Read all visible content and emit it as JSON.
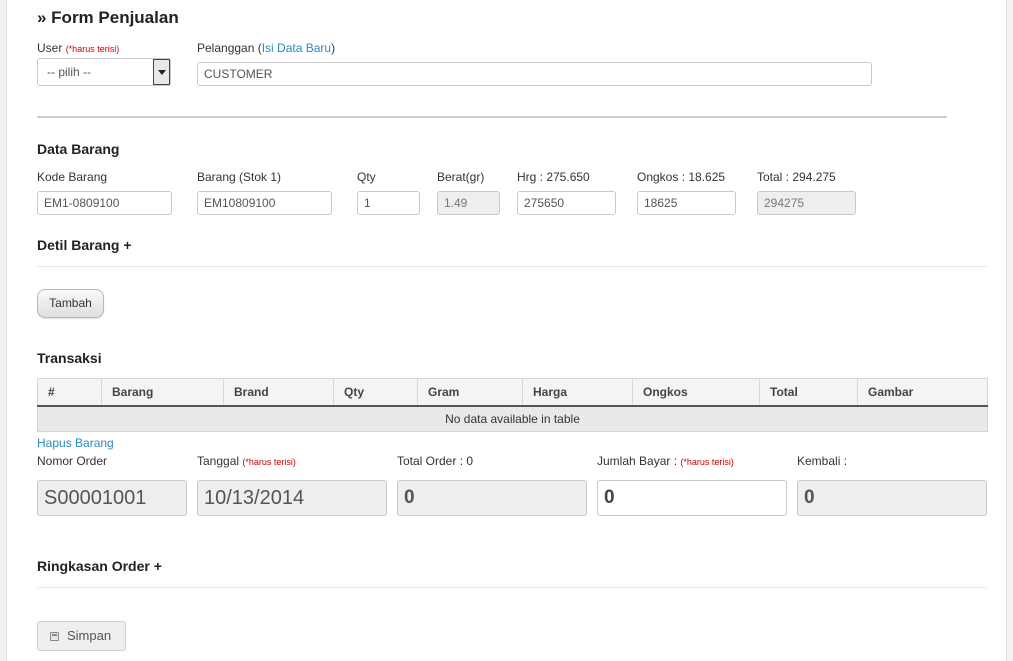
{
  "title": "» Form Penjualan",
  "user": {
    "label": "User",
    "required": "(*harus terisi)",
    "select_value": "-- pilih --"
  },
  "pelanggan": {
    "label_prefix": "Pelanggan (",
    "link": "Isi Data Baru",
    "label_suffix": ")",
    "value": "CUSTOMER"
  },
  "data_barang": {
    "heading": "Data Barang",
    "fields": [
      {
        "label": "Kode Barang",
        "value": "EM1-0809100"
      },
      {
        "label": "Barang (Stok 1)",
        "value": "EM10809100"
      },
      {
        "label": "Qty",
        "value": "1"
      },
      {
        "label": "Berat(gr)",
        "value": "1.49"
      },
      {
        "label": "Hrg : 275.650",
        "value": "275650"
      },
      {
        "label": "Ongkos : 18.625",
        "value": "18625"
      },
      {
        "label": "Total : 294.275",
        "value": "294275"
      }
    ]
  },
  "detil_barang": {
    "heading": "Detil Barang +"
  },
  "tambah_button": "Tambah",
  "transaksi": {
    "heading": "Transaksi",
    "columns": [
      "#",
      "Barang",
      "Brand",
      "Qty",
      "Gram",
      "Harga",
      "Ongkos",
      "Total",
      "Gambar"
    ],
    "empty_message": "No data available in table"
  },
  "hapus_barang": "Hapus Barang",
  "order": {
    "nomor_label": "Nomor Order",
    "nomor_value": "S00001001",
    "tanggal_label": "Tanggal",
    "tanggal_required": "(*harus terisi)",
    "tanggal_value": "10/13/2014",
    "total_label": "Total Order : 0",
    "total_value": "0",
    "bayar_label": "Jumlah Bayar :",
    "bayar_required": "(*harus terisi)",
    "bayar_value": "0",
    "kembali_label": "Kembali :",
    "kembali_value": "0"
  },
  "ringkasan": {
    "heading": "Ringkasan Order +"
  },
  "simpan_button": "Simpan",
  "icons": {
    "save": "save-icon",
    "select_arrow": "chevron-down-icon"
  }
}
